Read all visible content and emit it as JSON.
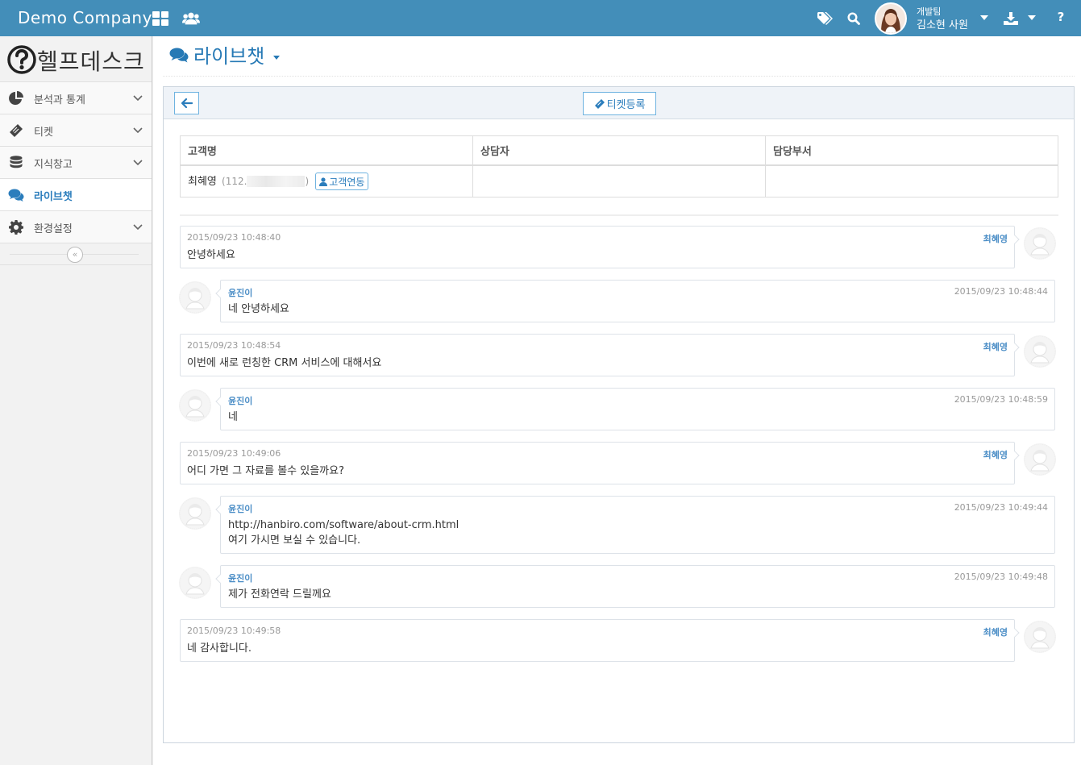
{
  "app": {
    "company": "Demo Company"
  },
  "topbar": {
    "user_team": "개발팀",
    "user_name": "김소현 사원",
    "help": "?"
  },
  "sidebar": {
    "logo_text": "헬프데스크",
    "items": [
      {
        "label": "분석과 통계",
        "icon": "pie-chart-icon",
        "expandable": true,
        "active": false
      },
      {
        "label": "티켓",
        "icon": "ticket-icon",
        "expandable": true,
        "active": false
      },
      {
        "label": "지식창고",
        "icon": "database-icon",
        "expandable": true,
        "active": false
      },
      {
        "label": "라이브챗",
        "icon": "chat-icon",
        "expandable": false,
        "active": true
      },
      {
        "label": "환경설정",
        "icon": "gear-icon",
        "expandable": true,
        "active": false
      }
    ],
    "collapse_icon": "«"
  },
  "page": {
    "title": "라이브챗",
    "ticket_button": "티켓등록"
  },
  "info_table": {
    "headers": [
      "고객명",
      "상담자",
      "담당부서"
    ],
    "customer_name": "최혜영",
    "customer_ip_prefix": "(112.",
    "customer_ip_suffix": ")",
    "link_button": "고객연동",
    "counselor": "",
    "department": ""
  },
  "messages": [
    {
      "side": "customer",
      "sender": "최혜영",
      "time": "2015/09/23 10:48:40",
      "lines": [
        "안녕하세요"
      ]
    },
    {
      "side": "agent",
      "sender": "윤진이",
      "time": "2015/09/23 10:48:44",
      "lines": [
        "네 안녕하세요"
      ]
    },
    {
      "side": "customer",
      "sender": "최혜영",
      "time": "2015/09/23 10:48:54",
      "lines": [
        "이번에 새로 런칭한 CRM 서비스에 대해서요"
      ]
    },
    {
      "side": "agent",
      "sender": "윤진이",
      "time": "2015/09/23 10:48:59",
      "lines": [
        "네"
      ]
    },
    {
      "side": "customer",
      "sender": "최혜영",
      "time": "2015/09/23 10:49:06",
      "lines": [
        "어디 가면 그 자료를 볼수 있을까요?"
      ]
    },
    {
      "side": "agent",
      "sender": "윤진이",
      "time": "2015/09/23 10:49:44",
      "lines": [
        "http://hanbiro.com/software/about-crm.html",
        "여기 가시면 보실 수 있습니다."
      ]
    },
    {
      "side": "agent",
      "sender": "윤진이",
      "time": "2015/09/23 10:49:48",
      "lines": [
        "제가 전화연락 드릴께요"
      ]
    },
    {
      "side": "customer",
      "sender": "최혜영",
      "time": "2015/09/23 10:49:58",
      "lines": [
        "네 감사합니다."
      ]
    }
  ],
  "colors": {
    "topbar": "#438eb9",
    "accent": "#2b7dbc",
    "sender": "#4a8dc6"
  }
}
